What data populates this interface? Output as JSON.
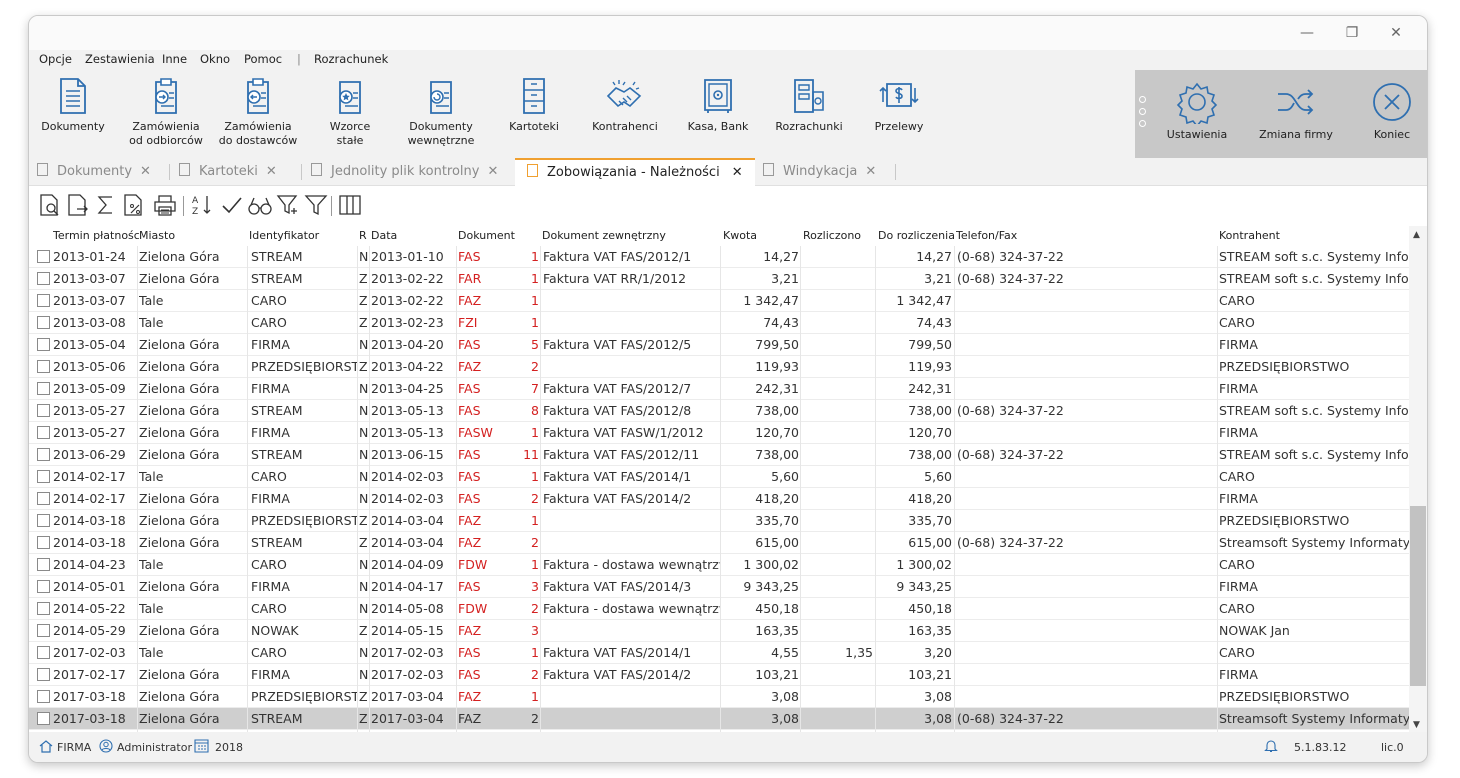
{
  "window": {
    "controls": [
      "—",
      "❐",
      "✕"
    ]
  },
  "menu": [
    "Opcje",
    "Zestawienia",
    "Inne",
    "Okno",
    "Pomoc",
    "|",
    "Rozrachunek"
  ],
  "ribbon": [
    {
      "l1": "Dokumenty",
      "l2": "",
      "icon": "document-icon"
    },
    {
      "l1": "Zamówienia",
      "l2": "od odbiorców",
      "icon": "order-in-icon"
    },
    {
      "l1": "Zamówienia",
      "l2": "do dostawców",
      "icon": "order-out-icon"
    },
    {
      "l1": "Wzorce",
      "l2": "stałe",
      "icon": "template-icon"
    },
    {
      "l1": "Dokumenty",
      "l2": "wewnętrzne",
      "icon": "internal-doc-icon"
    },
    {
      "l1": "Kartoteki",
      "l2": "",
      "icon": "cabinet-icon"
    },
    {
      "l1": "Kontrahenci",
      "l2": "",
      "icon": "handshake-icon"
    },
    {
      "l1": "Kasa, Bank",
      "l2": "",
      "icon": "safe-icon"
    },
    {
      "l1": "Rozrachunki",
      "l2": "",
      "icon": "settlement-icon"
    },
    {
      "l1": "Przelewy",
      "l2": "",
      "icon": "transfer-icon"
    }
  ],
  "ribbon_right": [
    {
      "label": "Ustawienia",
      "icon": "gear-icon"
    },
    {
      "label": "Zmiana firmy",
      "icon": "shuffle-icon"
    },
    {
      "label": "Koniec",
      "icon": "close-circle-icon"
    }
  ],
  "tabs": [
    {
      "label": "Dokumenty",
      "active": false
    },
    {
      "label": "Kartoteki",
      "active": false
    },
    {
      "label": "Jednolity plik kontrolny",
      "active": false
    },
    {
      "label": "Zobowiązania - Należności",
      "active": true
    },
    {
      "label": "Windykacja",
      "active": false
    }
  ],
  "toolbar_icons": [
    "preview-icon",
    "export-icon",
    "sum-icon",
    "percent-doc-icon",
    "print-icon",
    "sort-az-icon",
    "check-icon",
    "binoculars-icon",
    "filter-plus-icon",
    "filter-icon",
    "columns-icon"
  ],
  "grid": {
    "headers": [
      "Termin płatności",
      "Miasto",
      "Identyfikator",
      "R",
      "Data",
      "Dokument",
      "Dokument zewnętrzny",
      "Kwota",
      "Rozliczono",
      "Do rozliczenia",
      "Telefon/Fax",
      "Kontrahent"
    ],
    "rows": [
      [
        "2013-01-24",
        "Zielona Góra",
        "STREAM",
        "N",
        "2013-01-10",
        "FAS",
        "1",
        "Faktura VAT FAS/2012/1",
        "14,27",
        "",
        "14,27",
        "(0-68) 324-37-22",
        "STREAM soft s.c. Systemy Informatyczne"
      ],
      [
        "2013-03-07",
        "Zielona Góra",
        "STREAM",
        "Z",
        "2013-02-22",
        "FAR",
        "1",
        "Faktura VAT RR/1/2012",
        "3,21",
        "",
        "3,21",
        "(0-68) 324-37-22",
        "STREAM soft s.c. Systemy Informatyczne"
      ],
      [
        "2013-03-07",
        "Tale",
        "CARO",
        "Z",
        "2013-02-22",
        "FAZ",
        "1",
        "",
        "1 342,47",
        "",
        "1 342,47",
        "",
        "CARO"
      ],
      [
        "2013-03-08",
        "Tale",
        "CARO",
        "Z",
        "2013-02-23",
        "FZI",
        "1",
        "",
        "74,43",
        "",
        "74,43",
        "",
        "CARO"
      ],
      [
        "2013-05-04",
        "Zielona Góra",
        "FIRMA",
        "N",
        "2013-04-20",
        "FAS",
        "5",
        "Faktura VAT FAS/2012/5",
        "799,50",
        "",
        "799,50",
        "",
        "FIRMA"
      ],
      [
        "2013-05-06",
        "Zielona Góra",
        "PRZEDSIĘBIORSTWO",
        "Z",
        "2013-04-22",
        "FAZ",
        "2",
        "",
        "119,93",
        "",
        "119,93",
        "",
        "PRZEDSIĘBIORSTWO"
      ],
      [
        "2013-05-09",
        "Zielona Góra",
        "FIRMA",
        "N",
        "2013-04-25",
        "FAS",
        "7",
        "Faktura VAT FAS/2012/7",
        "242,31",
        "",
        "242,31",
        "",
        "FIRMA"
      ],
      [
        "2013-05-27",
        "Zielona Góra",
        "STREAM",
        "N",
        "2013-05-13",
        "FAS",
        "8",
        "Faktura VAT FAS/2012/8",
        "738,00",
        "",
        "738,00",
        "(0-68) 324-37-22",
        "STREAM soft s.c. Systemy Informatyczne"
      ],
      [
        "2013-05-27",
        "Zielona Góra",
        "FIRMA",
        "N",
        "2013-05-13",
        "FASW",
        "1",
        "Faktura VAT FASW/1/2012",
        "120,70",
        "",
        "120,70",
        "",
        "FIRMA"
      ],
      [
        "2013-06-29",
        "Zielona Góra",
        "STREAM",
        "N",
        "2013-06-15",
        "FAS",
        "11",
        "Faktura VAT FAS/2012/11",
        "738,00",
        "",
        "738,00",
        "(0-68) 324-37-22",
        "STREAM soft s.c. Systemy Informatyczne"
      ],
      [
        "2014-02-17",
        "Tale",
        "CARO",
        "N",
        "2014-02-03",
        "FAS",
        "1",
        "Faktura VAT FAS/2014/1",
        "5,60",
        "",
        "5,60",
        "",
        "CARO"
      ],
      [
        "2014-02-17",
        "Zielona Góra",
        "FIRMA",
        "N",
        "2014-02-03",
        "FAS",
        "2",
        "Faktura VAT FAS/2014/2",
        "418,20",
        "",
        "418,20",
        "",
        "FIRMA"
      ],
      [
        "2014-03-18",
        "Zielona Góra",
        "PRZEDSIĘBIORSTWO",
        "Z",
        "2014-03-04",
        "FAZ",
        "1",
        "",
        "335,70",
        "",
        "335,70",
        "",
        "PRZEDSIĘBIORSTWO"
      ],
      [
        "2014-03-18",
        "Zielona Góra",
        "STREAM",
        "Z",
        "2014-03-04",
        "FAZ",
        "2",
        "",
        "615,00",
        "",
        "615,00",
        "(0-68) 324-37-22",
        "Streamsoft Systemy Informatyczne"
      ],
      [
        "2014-04-23",
        "Tale",
        "CARO",
        "N",
        "2014-04-09",
        "FDW",
        "1",
        "Faktura - dostawa wewnątrzwspólnotowa",
        "1 300,02",
        "",
        "1 300,02",
        "",
        "CARO"
      ],
      [
        "2014-05-01",
        "Zielona Góra",
        "FIRMA",
        "N",
        "2014-04-17",
        "FAS",
        "3",
        "Faktura VAT FAS/2014/3",
        "9 343,25",
        "",
        "9 343,25",
        "",
        "FIRMA"
      ],
      [
        "2014-05-22",
        "Tale",
        "CARO",
        "N",
        "2014-05-08",
        "FDW",
        "2",
        "Faktura - dostawa wewnątrzwspólnotowa",
        "450,18",
        "",
        "450,18",
        "",
        "CARO"
      ],
      [
        "2014-05-29",
        "Zielona Góra",
        "NOWAK",
        "Z",
        "2014-05-15",
        "FAZ",
        "3",
        "",
        "163,35",
        "",
        "163,35",
        "",
        "NOWAK Jan"
      ],
      [
        "2017-02-03",
        "Tale",
        "CARO",
        "N",
        "2017-02-03",
        "FAS",
        "1",
        "Faktura VAT FAS/2014/1",
        "4,55",
        "1,35",
        "3,20",
        "",
        "CARO"
      ],
      [
        "2017-02-17",
        "Zielona Góra",
        "FIRMA",
        "N",
        "2017-02-03",
        "FAS",
        "2",
        "Faktura VAT FAS/2014/2",
        "103,21",
        "",
        "103,21",
        "",
        "FIRMA"
      ],
      [
        "2017-03-18",
        "Zielona Góra",
        "PRZEDSIĘBIORSTWO",
        "Z",
        "2017-03-04",
        "FAZ",
        "1",
        "",
        "3,08",
        "",
        "3,08",
        "",
        "PRZEDSIĘBIORSTWO"
      ],
      [
        "2017-03-18",
        "Zielona Góra",
        "STREAM",
        "Z",
        "2017-03-04",
        "FAZ",
        "2",
        "",
        "3,08",
        "",
        "3,08",
        "(0-68) 324-37-22",
        "Streamsoft Systemy Informatyczne"
      ]
    ],
    "selected_row": 21
  },
  "status": {
    "company": "FIRMA",
    "user": "Administrator",
    "year": "2018",
    "version": "5.1.83.12",
    "license": "lic.0"
  },
  "colors": {
    "accent": "#2f6fb0",
    "doc_red": "#d42020",
    "tab_active": "#f0a030"
  }
}
